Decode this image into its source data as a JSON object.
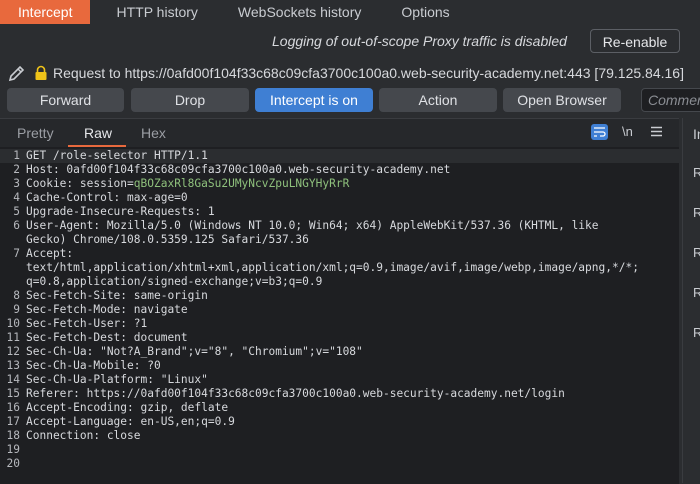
{
  "top_tabs": [
    "Intercept",
    "HTTP history",
    "WebSockets history",
    "Options"
  ],
  "logging": {
    "message": "Logging of out-of-scope Proxy traffic is disabled",
    "reenable_label": "Re-enable"
  },
  "request": {
    "label": "Request to https://0afd00f104f33c68c09cfa3700c100a0.web-security-academy.net:443  [79.125.84.16]"
  },
  "toolbar": {
    "forward": "Forward",
    "drop": "Drop",
    "intercept": "Intercept is on",
    "action": "Action",
    "open_browser": "Open Browser",
    "comment_placeholder": "Comment"
  },
  "editor": {
    "tabs": [
      "Pretty",
      "Raw",
      "Hex"
    ],
    "newline_label": "\\n",
    "lines": [
      {
        "n": "1",
        "t": "GET /role-selector HTTP/1.1"
      },
      {
        "n": "2",
        "t": "Host: 0afd00f104f33c68c09cfa3700c100a0.web-security-academy.net"
      },
      {
        "n": "3",
        "t": "Cookie: session=",
        "v": "qBOZaxRl8GaSu2UMyNcvZpuLNGYHyRrR"
      },
      {
        "n": "4",
        "t": "Cache-Control: max-age=0"
      },
      {
        "n": "5",
        "t": "Upgrade-Insecure-Requests: 1"
      },
      {
        "n": "6",
        "t": "User-Agent: Mozilla/5.0 (Windows NT 10.0; Win64; x64) AppleWebKit/537.36 (KHTML, like"
      },
      {
        "n": "",
        "t": "Gecko) Chrome/108.0.5359.125 Safari/537.36"
      },
      {
        "n": "7",
        "t": "Accept:"
      },
      {
        "n": "",
        "t": "text/html,application/xhtml+xml,application/xml;q=0.9,image/avif,image/webp,image/apng,*/*;"
      },
      {
        "n": "",
        "t": "q=0.8,application/signed-exchange;v=b3;q=0.9"
      },
      {
        "n": "8",
        "t": "Sec-Fetch-Site: same-origin"
      },
      {
        "n": "9",
        "t": "Sec-Fetch-Mode: navigate"
      },
      {
        "n": "10",
        "t": "Sec-Fetch-User: ?1"
      },
      {
        "n": "11",
        "t": "Sec-Fetch-Dest: document"
      },
      {
        "n": "12",
        "t": "Sec-Ch-Ua: \"Not?A_Brand\";v=\"8\", \"Chromium\";v=\"108\""
      },
      {
        "n": "13",
        "t": "Sec-Ch-Ua-Mobile: ?0"
      },
      {
        "n": "14",
        "t": "Sec-Ch-Ua-Platform: \"Linux\""
      },
      {
        "n": "15",
        "t": "Referer: https://0afd00f104f33c68c09cfa3700c100a0.web-security-academy.net/login"
      },
      {
        "n": "16",
        "t": "Accept-Encoding: gzip, deflate"
      },
      {
        "n": "17",
        "t": "Accept-Language: en-US,en;q=0.9"
      },
      {
        "n": "18",
        "t": "Connection: close"
      },
      {
        "n": "19",
        "t": ""
      },
      {
        "n": "20",
        "t": ""
      }
    ]
  },
  "side_panel": {
    "header": "In",
    "items": [
      "R",
      "R",
      "R",
      "R",
      "R"
    ]
  },
  "colors": {
    "accent": "#e8693d",
    "primary": "#3f7fd3",
    "cookie": "#8ec07c"
  }
}
